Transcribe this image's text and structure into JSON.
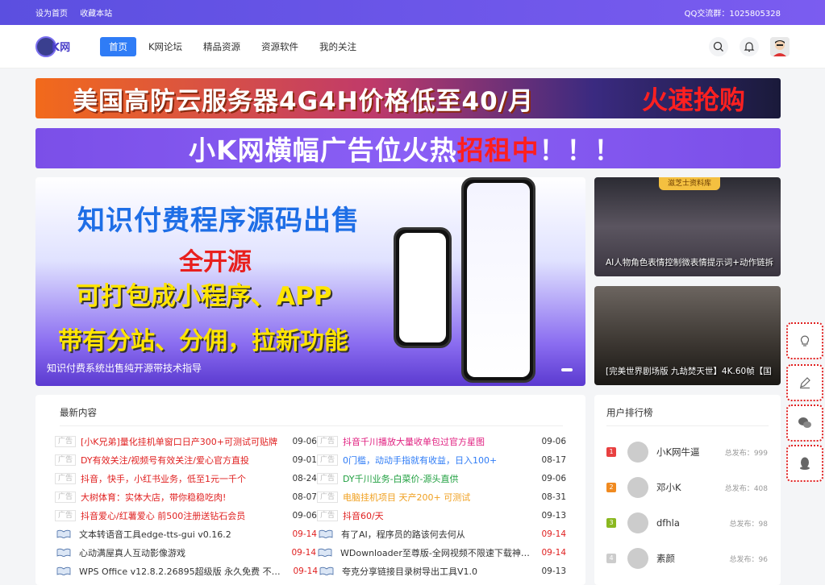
{
  "topbar": {
    "home": "设为首页",
    "fav": "收藏本站",
    "qq": "QQ交流群：1025805328"
  },
  "logo": {
    "text": "K网"
  },
  "menu": [
    "首页",
    "K网论坛",
    "精品资源",
    "资源软件",
    "我的关注"
  ],
  "banner1": {
    "text": "美国高防云服务器4G4H价格低至40/月",
    "cta": "火速抢购"
  },
  "banner2": {
    "pre": "小K网横幅广告位火热",
    "red": "招租中",
    "post": "！！！"
  },
  "hero": {
    "l1": "知识付费程序源码出售",
    "l2": "全开源",
    "l3": "可打包成小程序、APP",
    "l4": "带有分站、分佣，拉新功能",
    "caption": "知识付费系统出售纯开源带技术指导"
  },
  "side1": {
    "tag": "滋芝士资料库",
    "caption": "AI人物角色表情控制微表情提示词+动作链拆"
  },
  "side2": {
    "caption": "[完美世界剧场版 九劫焚天世】4K.60帧【国"
  },
  "latest": {
    "header": "最新内容",
    "ad_label": "广告",
    "rows": [
      [
        {
          "ad": true,
          "t": "[小K兄弟]量化挂机单窗口日产300+可测试可贴牌",
          "c": "#e02020",
          "d": "09-06"
        },
        {
          "ad": true,
          "t": "抖音千川播放大量收单包过官方星图",
          "c": "#e02080",
          "d": "09-06"
        }
      ],
      [
        {
          "ad": true,
          "t": "DY有效关注/视频号有效关注/爱心官方直投",
          "c": "#e02020",
          "d": "09-01"
        },
        {
          "ad": true,
          "t": "0门槛，动动手指就有收益，日入100+",
          "c": "#2f7cf6",
          "d": "08-17"
        }
      ],
      [
        {
          "ad": true,
          "t": "抖音，快手，小红书业务，低至1元一千个",
          "c": "#e02020",
          "d": "08-24"
        },
        {
          "ad": true,
          "t": "DY千川业务-白菜价-源头直供",
          "c": "#20a040",
          "d": "09-06"
        }
      ],
      [
        {
          "ad": true,
          "t": "大树体育：实体大店，带你稳稳吃肉!",
          "c": "#e02020",
          "d": "08-07"
        },
        {
          "ad": true,
          "t": "电脑挂机项目 天产200+ 可测试",
          "c": "#f0a020",
          "d": "08-31"
        }
      ],
      [
        {
          "ad": true,
          "t": "抖音爱心/红薯爱心 前500注册送钻石会员",
          "c": "#e02020",
          "d": "09-06"
        },
        {
          "ad": true,
          "t": "抖音60/天",
          "c": "#e02020",
          "d": "09-13"
        }
      ],
      [
        {
          "ad": false,
          "t": "文本转语音工具edge-tts-gui v0.16.2",
          "c": "#333",
          "d": "09-14",
          "red": true
        },
        {
          "ad": false,
          "t": "有了AI，程序员的路该何去何从",
          "c": "#333",
          "d": "09-14",
          "red": true
        }
      ],
      [
        {
          "ad": false,
          "t": "心动满屋真人互动影像游戏",
          "c": "#333",
          "d": "09-14",
          "red": true
        },
        {
          "ad": false,
          "t": "WDownloader至尊版-全网视频不限速下载神器...",
          "c": "#333",
          "d": "09-14",
          "red": true
        }
      ],
      [
        {
          "ad": false,
          "t": "WPS Office v12.8.2.26895超级版 永久免费 不用...",
          "c": "#333",
          "d": "09-14",
          "red": true
        },
        {
          "ad": false,
          "t": "夸克分享链接目录树导出工具V1.0",
          "c": "#333",
          "d": "09-13"
        }
      ]
    ]
  },
  "rank": {
    "header": "用户排行榜",
    "post_label": "总发布：",
    "users": [
      {
        "n": "1",
        "name": "小K网牛逼",
        "count": "999",
        "color": "#e84040"
      },
      {
        "n": "2",
        "name": "邓小K",
        "count": "408",
        "color": "#f08a20"
      },
      {
        "n": "3",
        "name": "dfhla",
        "count": "98",
        "color": "#8ab820"
      },
      {
        "n": "4",
        "name": "素颜",
        "count": "96",
        "color": "#ccc"
      }
    ]
  },
  "colors": {
    "accent": "#2f7cf6",
    "brand": "#5b4fe0"
  }
}
